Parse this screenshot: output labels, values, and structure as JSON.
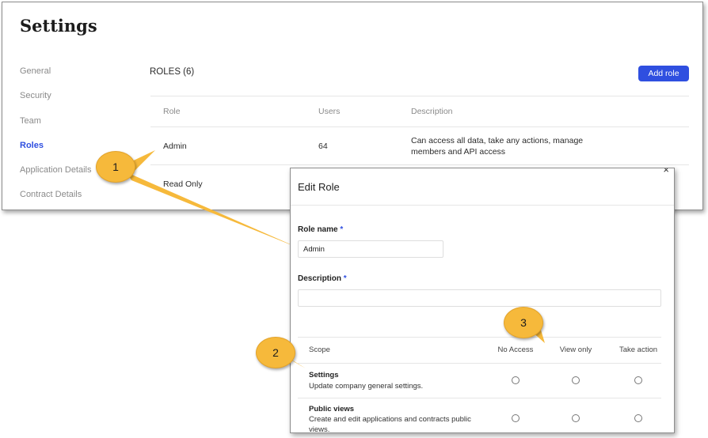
{
  "settings": {
    "title": "Settings",
    "sidebar": {
      "items": [
        {
          "label": "General"
        },
        {
          "label": "Security"
        },
        {
          "label": "Team"
        },
        {
          "label": "Roles"
        },
        {
          "label": "Application Details"
        },
        {
          "label": "Contract Details"
        }
      ],
      "active": "Roles"
    },
    "roles": {
      "header": "ROLES (6)",
      "add_button": "Add role",
      "columns": {
        "role": "Role",
        "users": "Users",
        "description": "Description"
      },
      "rows": [
        {
          "role": "Admin",
          "users": "64",
          "description": "Can access all data, take any actions, manage members and API access"
        },
        {
          "role": "Read Only",
          "users": "",
          "description": ""
        }
      ]
    }
  },
  "modal": {
    "title": "Edit Role",
    "close": "×",
    "role_name_label": "Role name",
    "required_mark": "*",
    "role_name_value": "Admin",
    "description_label": "Description",
    "scope_table": {
      "columns": {
        "scope": "Scope",
        "no_access": "No Access",
        "view_only": "View only",
        "take_action": "Take action"
      },
      "rows": [
        {
          "name": "Settings",
          "description": "Update company general settings."
        },
        {
          "name": "Public views",
          "description": "Create and edit applications and contracts public views."
        }
      ]
    }
  },
  "callouts": {
    "one": "1",
    "two": "2",
    "three": "3"
  },
  "colors": {
    "accent": "#2f4fe0",
    "callout": "#f6b93b"
  }
}
